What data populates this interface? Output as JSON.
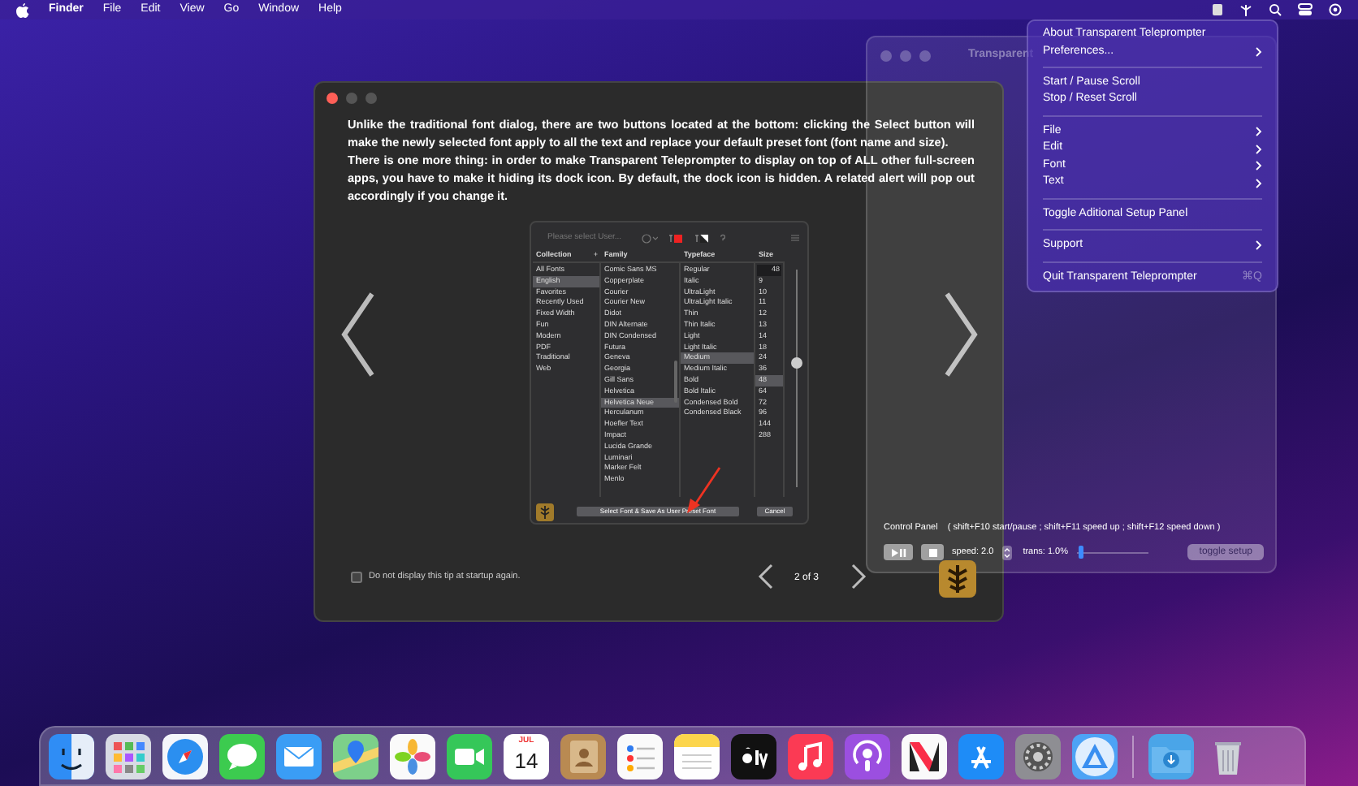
{
  "menu_bar": {
    "app": "Finder",
    "items": [
      "File",
      "Edit",
      "View",
      "Go",
      "Window",
      "Help"
    ]
  },
  "teleprompter_window": {
    "title": "Transparent",
    "control_panel": {
      "label": "Control Panel",
      "shortcuts": "( shift+F10 start/pause ; shift+F11 speed up ; shift+F12 speed down )",
      "speed": "speed: 2.0",
      "trans": "trans: 1.0%",
      "trans_slider": {
        "level": 0.04
      },
      "toggle_button": "toggle setup"
    }
  },
  "app_menu": {
    "items": [
      {
        "kind": "item",
        "label": "About Transparent Teleprompter"
      },
      {
        "kind": "item",
        "label": "Preferences...",
        "submenu": true
      },
      {
        "kind": "separator"
      },
      {
        "kind": "item",
        "label": "Start / Pause Scroll"
      },
      {
        "kind": "item",
        "label": "Stop / Reset Scroll"
      },
      {
        "kind": "separator"
      },
      {
        "kind": "item",
        "label": "File",
        "submenu": true
      },
      {
        "kind": "item",
        "label": "Edit",
        "submenu": true
      },
      {
        "kind": "item",
        "label": "Font",
        "submenu": true
      },
      {
        "kind": "item",
        "label": "Text",
        "submenu": true
      },
      {
        "kind": "separator"
      },
      {
        "kind": "item",
        "label": "Toggle Aditional Setup Panel"
      },
      {
        "kind": "separator"
      },
      {
        "kind": "item",
        "label": "Support",
        "submenu": true
      },
      {
        "kind": "separator"
      },
      {
        "kind": "item",
        "label": "Quit Transparent Teleprompter",
        "shortcut": "⌘Q"
      }
    ]
  },
  "tip_window": {
    "paragraphs": [
      "Unlike the traditional font dialog, there are two buttons located at the bottom: clicking the Select button will make the newly selected font apply to all the text and replace your default preset font (font name and size).",
      "There is one more thing: in order to make Transparent Teleprompter to display on top of ALL other full-screen apps, you have to make it hiding its dock icon. By default, the dock icon is hidden. A related alert will pop out accordingly if you change it."
    ],
    "font_panel": {
      "placeholder": "Please select User...",
      "columns": [
        {
          "header": "Collection",
          "add": "+",
          "items": [
            {
              "label": "All Fonts",
              "selected": false
            },
            {
              "label": "English",
              "selected": true
            },
            {
              "label": "Favorites",
              "selected": false
            },
            {
              "label": "Recently Used",
              "selected": false
            },
            {
              "label": "Fixed Width",
              "selected": false
            },
            {
              "label": "Fun",
              "selected": false
            },
            {
              "label": "Modern",
              "selected": false
            },
            {
              "label": "PDF",
              "selected": false
            },
            {
              "label": "Traditional",
              "selected": false
            },
            {
              "label": "Web",
              "selected": false
            }
          ]
        },
        {
          "header": "Family",
          "items": [
            {
              "label": "Comic Sans MS",
              "selected": false
            },
            {
              "label": "Copperplate",
              "selected": false
            },
            {
              "label": "Courier",
              "selected": false
            },
            {
              "label": "Courier New",
              "selected": false
            },
            {
              "label": "Didot",
              "selected": false
            },
            {
              "label": "DIN Alternate",
              "selected": false
            },
            {
              "label": "DIN Condensed",
              "selected": false
            },
            {
              "label": "Futura",
              "selected": false
            },
            {
              "label": "Geneva",
              "selected": false
            },
            {
              "label": "Georgia",
              "selected": false
            },
            {
              "label": "Gill Sans",
              "selected": false
            },
            {
              "label": "Helvetica",
              "selected": false
            },
            {
              "label": "Helvetica Neue",
              "selected": true
            },
            {
              "label": "Herculanum",
              "selected": false
            },
            {
              "label": "Hoefler Text",
              "selected": false
            },
            {
              "label": "Impact",
              "selected": false
            },
            {
              "label": "Lucida Grande",
              "selected": false
            },
            {
              "label": "Luminari",
              "selected": false
            },
            {
              "label": "Marker Felt",
              "selected": false
            },
            {
              "label": "Menlo",
              "selected": false
            }
          ]
        },
        {
          "header": "Typeface",
          "items": [
            {
              "label": "Regular",
              "selected": false
            },
            {
              "label": "Italic",
              "selected": false
            },
            {
              "label": "UltraLight",
              "selected": false
            },
            {
              "label": "UltraLight Italic",
              "selected": false
            },
            {
              "label": "Thin",
              "selected": false
            },
            {
              "label": "Thin Italic",
              "selected": false
            },
            {
              "label": "Light",
              "selected": false
            },
            {
              "label": "Light Italic",
              "selected": false
            },
            {
              "label": "Medium",
              "selected": true
            },
            {
              "label": "Medium Italic",
              "selected": false
            },
            {
              "label": "Bold",
              "selected": false
            },
            {
              "label": "Bold Italic",
              "selected": false
            },
            {
              "label": "Condensed Bold",
              "selected": false
            },
            {
              "label": "Condensed Black",
              "selected": false
            }
          ]
        },
        {
          "header": "Size",
          "field": "48",
          "items": [
            {
              "label": "9",
              "selected": false
            },
            {
              "label": "10",
              "selected": false
            },
            {
              "label": "11",
              "selected": false
            },
            {
              "label": "12",
              "selected": false
            },
            {
              "label": "13",
              "selected": false
            },
            {
              "label": "14",
              "selected": false
            },
            {
              "label": "18",
              "selected": false
            },
            {
              "label": "24",
              "selected": false
            },
            {
              "label": "36",
              "selected": false
            },
            {
              "label": "48",
              "selected": true
            },
            {
              "label": "64",
              "selected": false
            },
            {
              "label": "72",
              "selected": false
            },
            {
              "label": "96",
              "selected": false
            },
            {
              "label": "144",
              "selected": false
            },
            {
              "label": "288",
              "selected": false
            }
          ]
        }
      ],
      "size_slider": {
        "level": 0.55
      },
      "select_button": "Select Font & Save As User Preset Font",
      "cancel_button": "Cancel"
    },
    "checkbox": {
      "label": "Do not display this tip at startup again.",
      "checked": false
    },
    "page": "2 of 3"
  },
  "dock": {
    "items": [
      {
        "kind": "finder"
      },
      {
        "kind": "launchpad"
      },
      {
        "kind": "safari"
      },
      {
        "kind": "messages"
      },
      {
        "kind": "mail"
      },
      {
        "kind": "maps"
      },
      {
        "kind": "photos"
      },
      {
        "kind": "facetime"
      },
      {
        "kind": "calendar",
        "month": "JUL",
        "day": "14"
      },
      {
        "kind": "contacts"
      },
      {
        "kind": "reminders"
      },
      {
        "kind": "notes"
      },
      {
        "kind": "tv"
      },
      {
        "kind": "music"
      },
      {
        "kind": "podcasts"
      },
      {
        "kind": "news"
      },
      {
        "kind": "appstore"
      },
      {
        "kind": "settings"
      },
      {
        "kind": "triangle-app"
      },
      {
        "kind": "divider"
      },
      {
        "kind": "downloads"
      },
      {
        "kind": "trash"
      }
    ]
  }
}
